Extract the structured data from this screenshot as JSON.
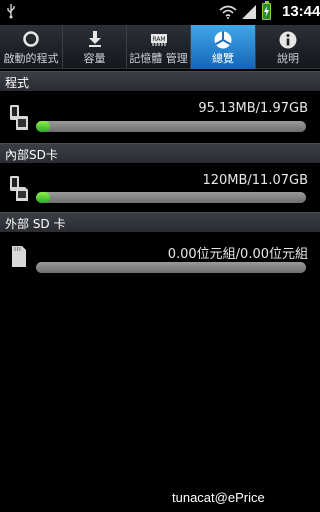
{
  "status_bar": {
    "time": "13:44",
    "icons": [
      "usb-icon",
      "wifi-icon",
      "signal-icon",
      "battery-charging-icon"
    ]
  },
  "tabs": [
    {
      "label": "啟動的程式",
      "icon": "circle-icon",
      "active": false
    },
    {
      "label": "容量",
      "icon": "download-icon",
      "active": false
    },
    {
      "label": "記憶體 管理",
      "icon": "ram-chip-icon",
      "active": false
    },
    {
      "label": "總覽",
      "icon": "pie-chart-icon",
      "active": true
    },
    {
      "label": "說明",
      "icon": "info-icon",
      "active": false
    }
  ],
  "sections": [
    {
      "title": "程式",
      "usage": "95.13MB/1.97GB",
      "fraction": 0.047,
      "icon": "phone-storage-icon"
    },
    {
      "title": "內部SD卡",
      "usage": "120MB/11.07GB",
      "fraction": 0.011,
      "icon": "internal-sd-icon"
    },
    {
      "title": "外部 SD 卡",
      "usage": "0.00位元組/0.00位元組",
      "fraction": 0.0,
      "icon": "sd-card-icon"
    }
  ],
  "watermark": "tunacat@ePrice",
  "colors": {
    "accent": "#2a8ad6",
    "bar_fill": "#4fd13a",
    "bar_track": "#8a8a8a"
  }
}
